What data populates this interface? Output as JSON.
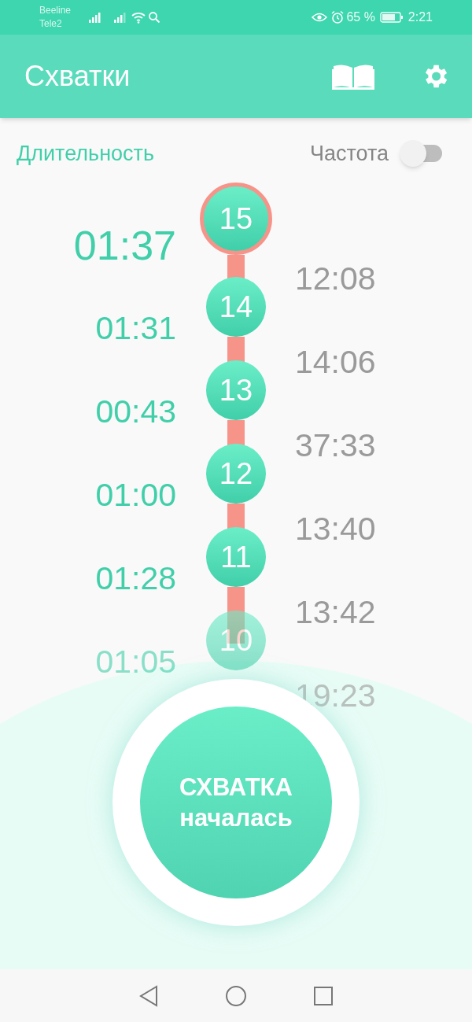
{
  "status_bar": {
    "carrier_1": "Beeline",
    "carrier_2": "Tele2",
    "battery": "65 %",
    "time": "2:21"
  },
  "app_bar": {
    "title": "Схватки"
  },
  "header": {
    "duration_label": "Длительность",
    "frequency_label": "Частота",
    "frequency_on": false
  },
  "contractions": [
    {
      "number": "15",
      "duration": "01:37",
      "interval": "12:08",
      "selected": true,
      "faded": false
    },
    {
      "number": "14",
      "duration": "01:31",
      "interval": "14:06",
      "selected": false,
      "faded": false
    },
    {
      "number": "13",
      "duration": "00:43",
      "interval": "37:33",
      "selected": false,
      "faded": false
    },
    {
      "number": "12",
      "duration": "01:00",
      "interval": "13:40",
      "selected": false,
      "faded": false
    },
    {
      "number": "11",
      "duration": "01:28",
      "interval": "13:42",
      "selected": false,
      "faded": false
    },
    {
      "number": "10",
      "duration": "01:05",
      "interval": "19:23",
      "selected": false,
      "faded": true
    }
  ],
  "start_button": {
    "line_1": "СХВАТКА",
    "line_2": "началась"
  }
}
